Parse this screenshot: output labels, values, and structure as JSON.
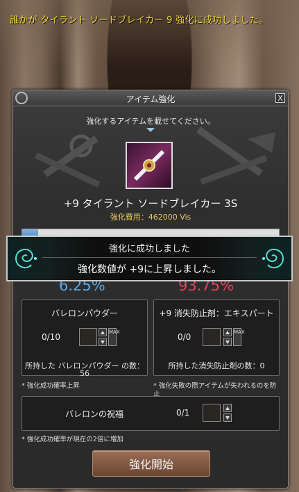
{
  "notice": "誰かが タイラント ソードブレイカー 9 強化に成功しました。",
  "window": {
    "title": "アイテム強化",
    "close_label": "X",
    "instruction": "強化するアイテムを載せてください。"
  },
  "item": {
    "name": "+9 タイラント ソードブレイカー 3S",
    "cost": "強化費用：462000 Vis"
  },
  "rates": {
    "success": "6.25%",
    "fail": "93.75%",
    "success_fraction": 0.0625
  },
  "powder": {
    "title": "バレロンパウダー",
    "count": "0/10",
    "max_label": "MAX",
    "owned_line1": "所持した バレロンパウダー の数：",
    "owned_line2": "56",
    "note": "* 強化成功確率上昇"
  },
  "protector": {
    "title": "+9 消失防止剤：エキスパート",
    "count": "0/0",
    "max_label": "MAX",
    "owned": "所持した消失防止剤の数：0",
    "note_line1": "* 強化失敗の際アイテムが失われるのを防",
    "note_line2": "止"
  },
  "blessing": {
    "title": "バレロンの祝福",
    "count": "0/1",
    "note": "* 強化成功確率が現在の2倍に増加"
  },
  "start_button": "強化開始",
  "result": {
    "line1": "強化に成功しました",
    "line2": "強化数値が +9に上昇しました。"
  },
  "colors": {
    "notice": "#f3d63a",
    "success_rate": "#5aa8e8",
    "fail_rate": "#e0465a",
    "cost": "#e8c95a"
  }
}
